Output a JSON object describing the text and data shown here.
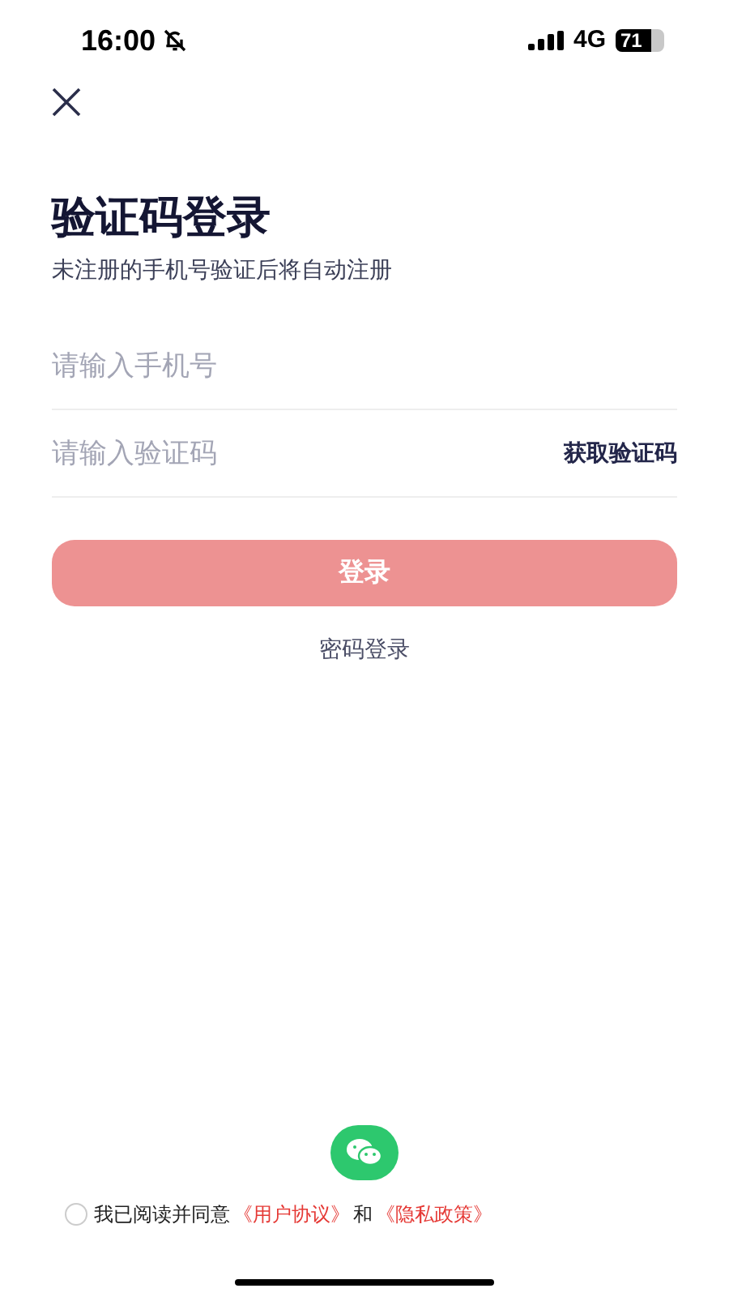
{
  "status_bar": {
    "time": "16:00",
    "network": "4G",
    "battery": "71"
  },
  "title": "验证码登录",
  "subtitle": "未注册的手机号验证后将自动注册",
  "fields": [
    {
      "placeholder": "请输入手机号"
    },
    {
      "placeholder": "请输入验证码",
      "action": "获取验证码"
    }
  ],
  "login_button": {
    "label": "登录",
    "disabled": true
  },
  "alt_login": "密码登录",
  "agreement": {
    "checked": false,
    "text": "我已阅读并同意",
    "link1": "《用户协议》",
    "joiner": "和",
    "link2": "《隐私政策》"
  }
}
